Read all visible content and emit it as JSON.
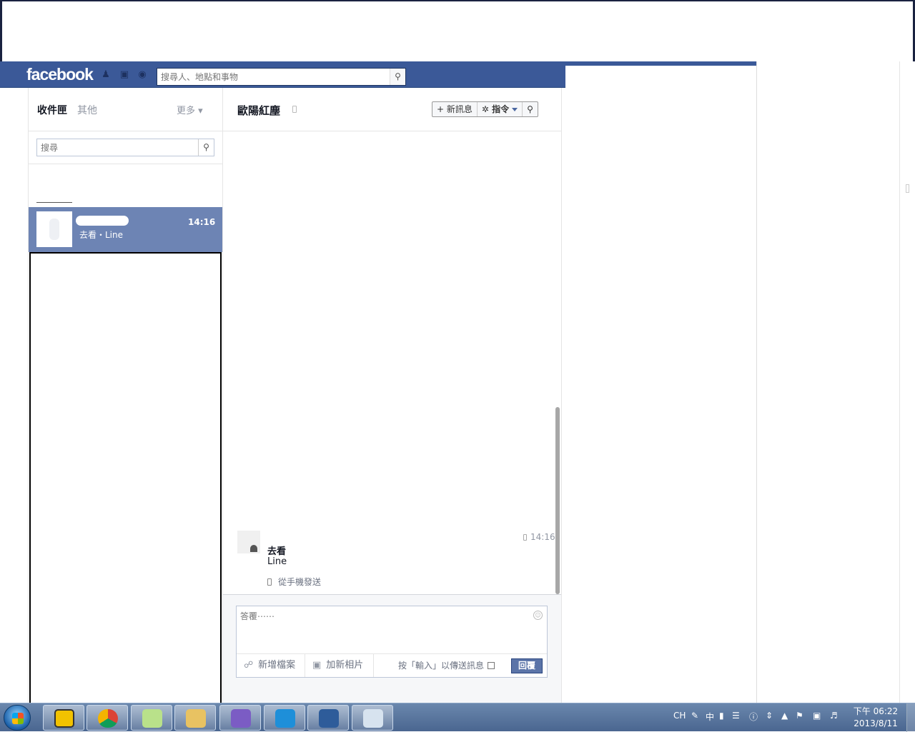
{
  "fb": {
    "logo": "facebook",
    "search_placeholder": "搜尋人、地點和事物"
  },
  "inbox": {
    "tab_inbox": "收件匣",
    "tab_other": "其他",
    "more": "更多 ▾",
    "search_placeholder": "搜尋",
    "thread": {
      "snippet": "去看・Line",
      "time": "14:16"
    }
  },
  "conversation": {
    "title": "歐陽紅塵",
    "new_message": "+ 新訊息",
    "actions": "✲ 指令",
    "message": {
      "time": "14:16",
      "line1": "去看",
      "line2": "Line",
      "source": "從手機發送"
    },
    "composer": {
      "placeholder": "答覆⋯⋯",
      "attach": "新增檔案",
      "photo": "加新相片",
      "enter_hint": "按「輸入」以傳送訊息",
      "reply": "回覆"
    }
  },
  "taskbar": {
    "lang": "CH",
    "ime": "中",
    "time": "下午 06:22",
    "date": "2013/8/11"
  }
}
